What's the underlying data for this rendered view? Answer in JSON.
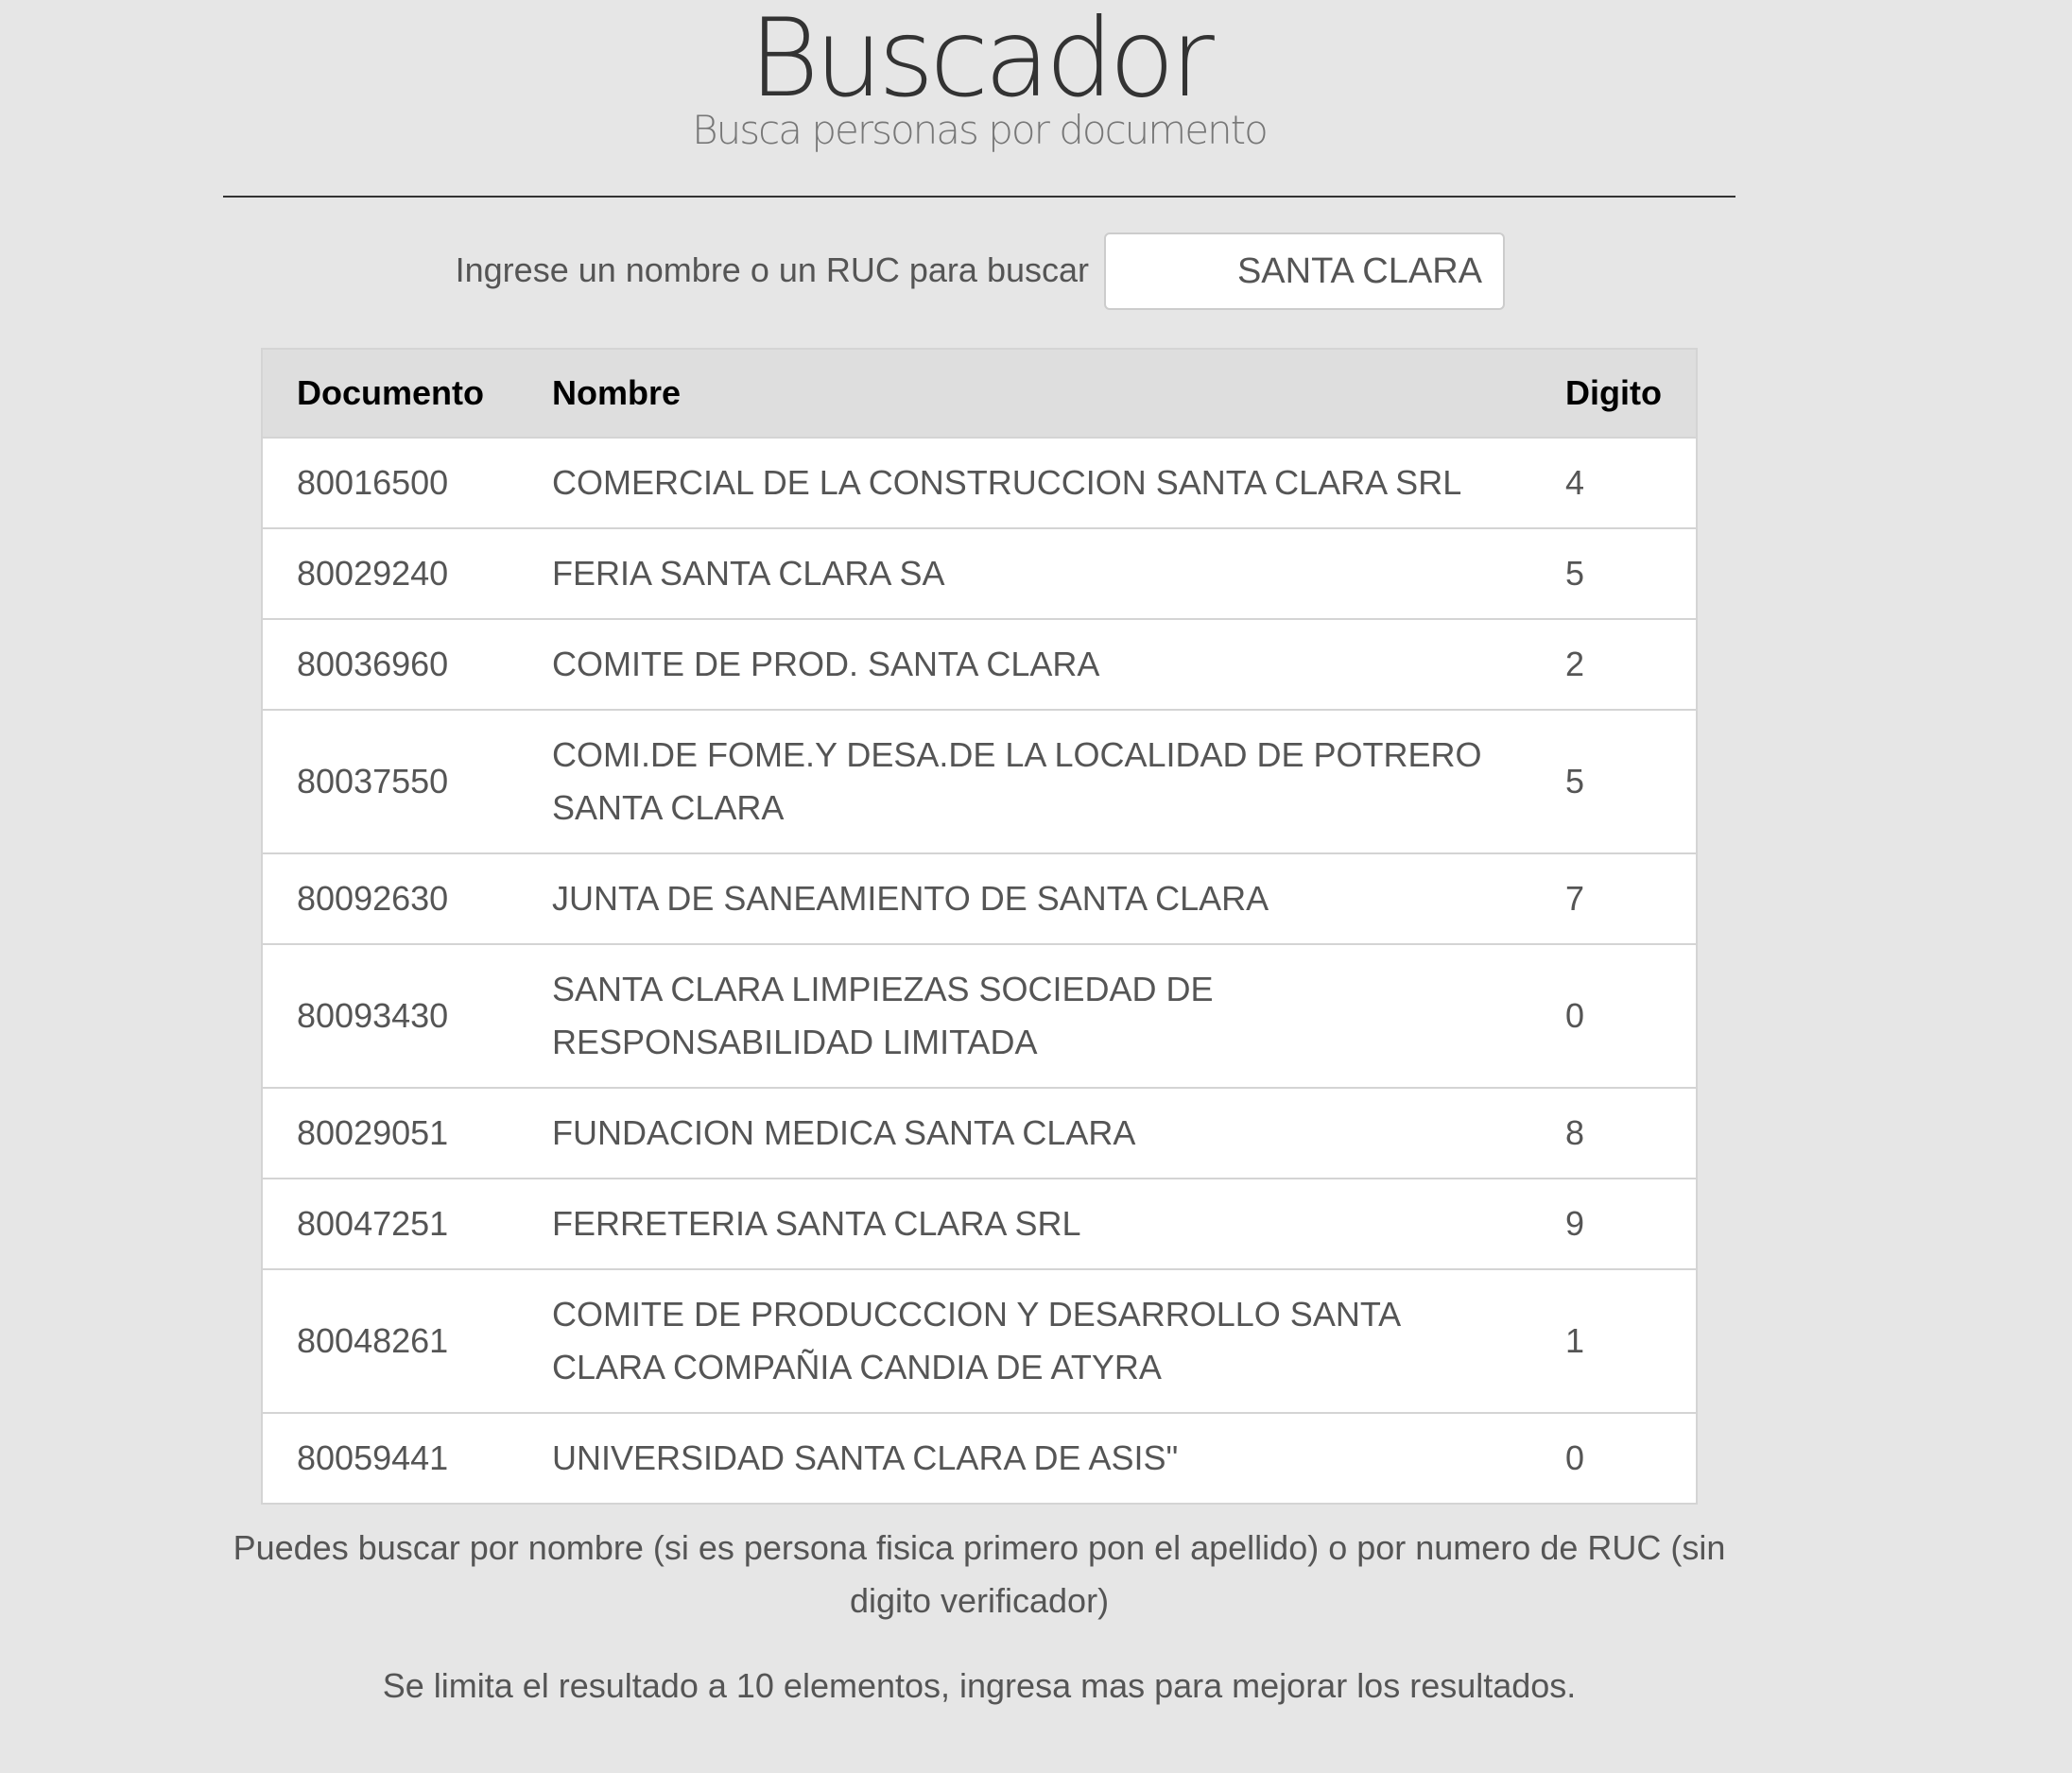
{
  "header": {
    "title": "Buscador",
    "subtitle": "Busca personas por documento"
  },
  "search": {
    "label": "Ingrese un nombre o un RUC para buscar",
    "value": "SANTA CLARA"
  },
  "table": {
    "headers": [
      "Documento",
      "Nombre",
      "Digito"
    ],
    "rows": [
      {
        "documento": "80016500",
        "nombre": "COMERCIAL DE LA CONSTRUCCION SANTA CLARA SRL",
        "digito": "4"
      },
      {
        "documento": "80029240",
        "nombre": "FERIA SANTA CLARA SA",
        "digito": "5"
      },
      {
        "documento": "80036960",
        "nombre": "COMITE DE PROD. SANTA CLARA",
        "digito": "2"
      },
      {
        "documento": "80037550",
        "nombre": "COMI.DE FOME.Y DESA.DE LA LOCALIDAD DE POTRERO SANTA CLARA",
        "digito": "5"
      },
      {
        "documento": "80092630",
        "nombre": "JUNTA DE SANEAMIENTO DE SANTA CLARA",
        "digito": "7"
      },
      {
        "documento": "80093430",
        "nombre": "SANTA CLARA LIMPIEZAS SOCIEDAD DE RESPONSABILIDAD LIMITADA",
        "digito": "0"
      },
      {
        "documento": "80029051",
        "nombre": "FUNDACION MEDICA SANTA CLARA",
        "digito": "8"
      },
      {
        "documento": "80047251",
        "nombre": "FERRETERIA SANTA CLARA SRL",
        "digito": "9"
      },
      {
        "documento": "80048261",
        "nombre": "COMITE DE PRODUCCCION Y DESARROLLO SANTA CLARA COMPAÑIA CANDIA DE ATYRA",
        "digito": "1"
      },
      {
        "documento": "80059441",
        "nombre": "UNIVERSIDAD SANTA CLARA DE ASIS\"",
        "digito": "0"
      }
    ]
  },
  "notes": {
    "hint": "Puedes buscar por nombre (si es persona fisica primero pon el apellido) o por numero de RUC (sin digito verificador)",
    "limit": "Se limita el resultado a 10 elementos, ingresa mas para mejorar los resultados."
  }
}
